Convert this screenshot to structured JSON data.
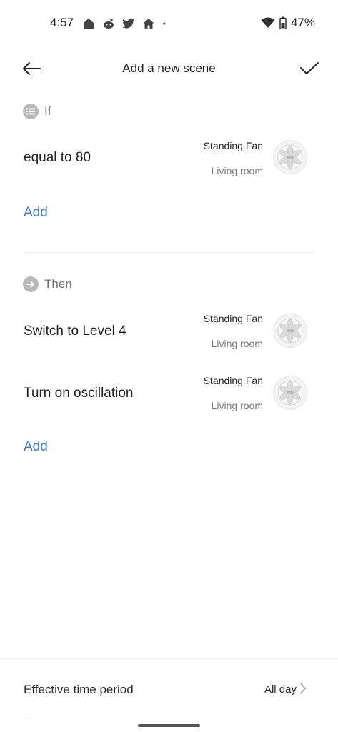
{
  "status_bar": {
    "time": "4:57",
    "battery": "47%",
    "notification_icons": [
      "poe-icon",
      "reddit-icon",
      "twitter-icon",
      "home-icon",
      "dot-icon"
    ]
  },
  "header": {
    "title": "Add a new scene"
  },
  "if_section": {
    "label": "If",
    "conditions": [
      {
        "title": "equal to 80",
        "device": "Standing Fan",
        "room": "Living room"
      }
    ],
    "add_label": "Add"
  },
  "then_section": {
    "label": "Then",
    "actions": [
      {
        "title": "Switch to Level 4",
        "device": "Standing Fan",
        "room": "Living room"
      },
      {
        "title": "Turn on oscillation",
        "device": "Standing Fan",
        "room": "Living room"
      }
    ],
    "add_label": "Add"
  },
  "footer": {
    "label": "Effective time period",
    "value": "All day"
  },
  "colors": {
    "accent": "#3d7bd0",
    "secondary_text": "#7a7a7a",
    "section_icon": "#b9b9b9"
  }
}
